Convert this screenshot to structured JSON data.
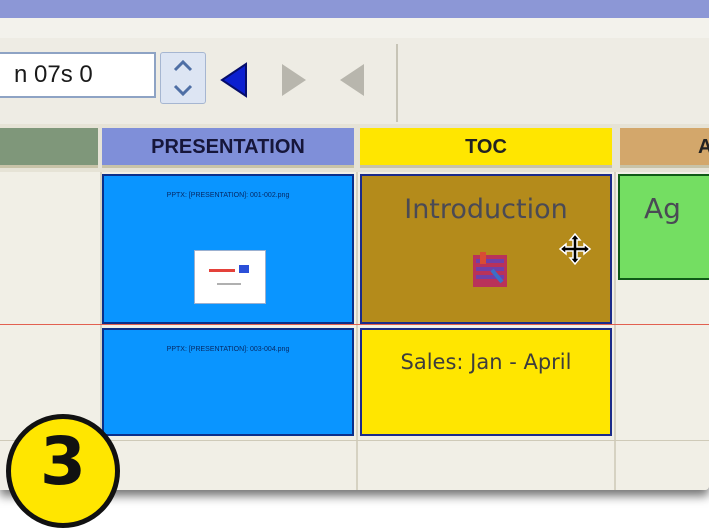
{
  "toolbar": {
    "time_value": "n 07s 0",
    "spinner_up_icon": "chevron-up",
    "spinner_down_icon": "chevron-down",
    "nav_buttons": [
      "triangle-left-blue",
      "triangle-right-gray",
      "triangle-left-gray"
    ]
  },
  "columns": {
    "col0": "",
    "col1": "PRESENTATION",
    "col2": "TOC",
    "col3": "A"
  },
  "colors": {
    "presentation_header": "#7f8fd9",
    "toc_header": "#ffe600",
    "agenda_header": "#d3a76b",
    "presentation_cell": "#0a95ff",
    "toc_selected": "#b48b1b",
    "toc_cell": "#ffe600",
    "agenda_cell": "#74de62"
  },
  "rows": [
    {
      "presentation": {
        "label": "PPTX: [PRESENTATION]: 001-002.png",
        "has_thumbnail": true
      },
      "toc": {
        "text": "Introduction",
        "selected": true
      },
      "agenda": {
        "text": "Ag"
      }
    },
    {
      "presentation": {
        "label": "PPTX: [PRESENTATION]: 003-004.png",
        "has_thumbnail": false
      },
      "toc": {
        "text": "Sales: Jan - April",
        "selected": false
      }
    }
  ],
  "step_badge": "3"
}
